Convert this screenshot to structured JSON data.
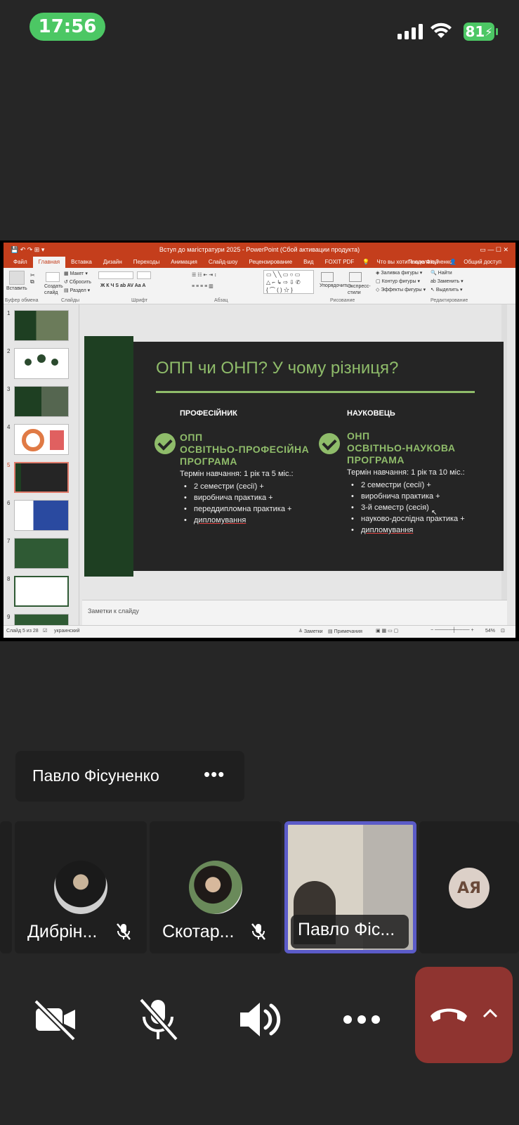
{
  "status_bar": {
    "time": "17:56",
    "battery": "81"
  },
  "ppt": {
    "window_title": "Вступ до магістратури 2025 - PowerPoint (Сбой активации продукта)",
    "tabs": [
      "Файл",
      "Главная",
      "Вставка",
      "Дизайн",
      "Переходы",
      "Анимация",
      "Слайд-шоу",
      "Рецензирование",
      "Вид",
      "FOXIT PDF"
    ],
    "tell_me": "Что вы хотите сделать?",
    "user": "Павло Фісуненко",
    "share": "Общий доступ",
    "ribbon": {
      "paste": "Вставить",
      "create_slide": "Создать слайд",
      "layout": "Макет",
      "reset": "Сбросить",
      "section": "Раздел",
      "arrange": "Упорядочить",
      "express_styles": "Экспресс-стили",
      "fill": "Заливка фигуры",
      "outline": "Контур фигуры",
      "effects": "Эффекты фигуры",
      "find": "Найти",
      "replace": "Заменить",
      "select": "Выделить",
      "groups": [
        "Буфер обмена",
        "Слайды",
        "Шрифт",
        "Абзац",
        "Рисование",
        "Редактирование"
      ]
    },
    "thumb_numbers": [
      "1",
      "2",
      "3",
      "4",
      "5",
      "6",
      "7",
      "8",
      "9"
    ],
    "notes": "Заметки к слайду",
    "statusbar": {
      "slide": "Слайд 5 из 28",
      "lang": "украинский",
      "notes_btn": "Заметки",
      "comments_btn": "Примечания",
      "zoom": "54%"
    },
    "slide": {
      "title": "ОПП чи ОНП? У чому різниця?",
      "left": {
        "head": "ПРОФЕСІЙНИК",
        "prog1": "ОПП",
        "prog2": "ОСВІТНЬО-ПРОФЕСІЙНА",
        "prog3": "ПРОГРАМА",
        "term": "Термін навчання: 1 рік та 5 міс.:",
        "b1": "2 семестри (сесії) +",
        "b2": "виробнича практика +",
        "b3": "переддипломна практика +",
        "b4": "дипломування"
      },
      "right": {
        "head": "НАУКОВЕЦЬ",
        "prog1": "ОНП",
        "prog2": "ОСВІТНЬО-НАУКОВА",
        "prog3": "ПРОГРАМА",
        "term": "Термін навчання: 1 рік та 10 міс.:",
        "b1": "2 семестри (сесії) +",
        "b2": "виробнича практика +",
        "b3": "3-й семестр (сесія)",
        "b4": "науково-дослідна практика +",
        "b5": "дипломування"
      }
    }
  },
  "speaker": {
    "name": "Павло Фісуненко",
    "more": "•••"
  },
  "participants": [
    {
      "name": "Дибрін...",
      "muted": true
    },
    {
      "name": "Скотар...",
      "muted": true
    },
    {
      "name": "Павло Фіс...",
      "active": true
    },
    {
      "initials": "АЯ"
    }
  ],
  "colors": {
    "hangup": "#8f3430",
    "active_border": "#5b5bc8",
    "accent_green": "#8fbc6a"
  }
}
